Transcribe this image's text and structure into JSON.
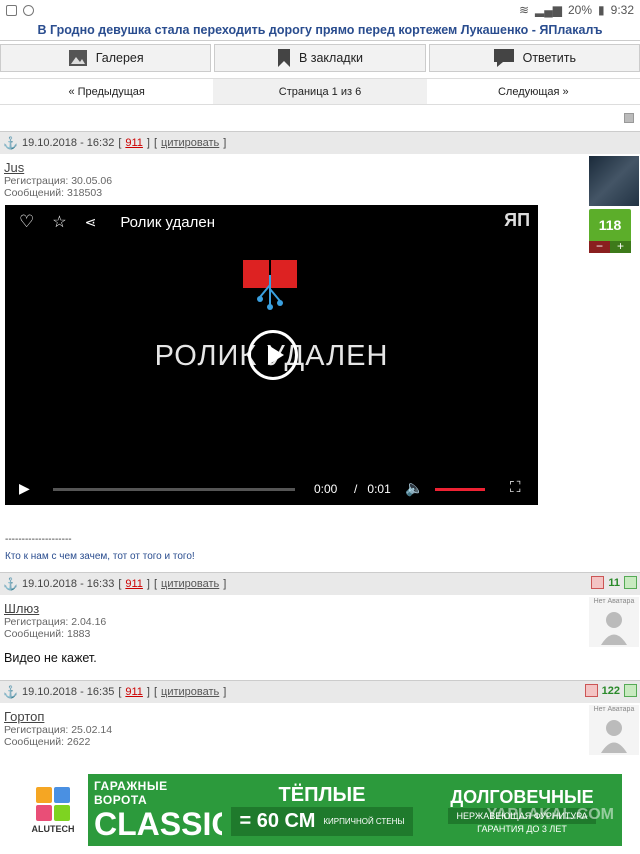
{
  "status": {
    "battery": "20%",
    "time": "9:32"
  },
  "title": "В Гродно девушка стала переходить дорогу прямо перед кортежем Лукашенко - ЯПлакалъ",
  "toolbar": {
    "gallery": "Галерея",
    "bookmarks": "В закладки",
    "reply": "Ответить"
  },
  "pager": {
    "prev": "« Предыдущая",
    "current": "Страница 1 из 6",
    "next": "Следующая »"
  },
  "posts": [
    {
      "date": "19.10.2018 - 16:32",
      "num": "911",
      "quote": "цитировать",
      "user": "Jus",
      "reg": "Регистрация: 30.05.06",
      "msgs": "Сообщений: 318503",
      "rating": "118",
      "minus": "−",
      "plus": "+",
      "video": {
        "title": "Ролик удален",
        "big": "РОЛИК УДАЛЕН",
        "logo": "ЯП",
        "time_cur": "0:00",
        "sep": "/",
        "time_total": "0:01"
      },
      "sig_line": "--------------------",
      "sig": "Кто к нам с чем зачем, тот от того и того!"
    },
    {
      "date": "19.10.2018 - 16:33",
      "num": "911",
      "quote": "цитировать",
      "user": "Шлюз",
      "reg": "Регистрация: 2.04.16",
      "msgs": "Сообщений: 1883",
      "rating": "11",
      "noavatar": "Нет Аватара",
      "text": "Видео не кажет."
    },
    {
      "date": "19.10.2018 - 16:35",
      "num": "911",
      "quote": "цитировать",
      "user": "Гортоп",
      "reg": "Регистрация: 25.02.14",
      "msgs": "Сообщений: 2622",
      "rating": "122",
      "noavatar": "Нет Аватара"
    }
  ],
  "banner": {
    "logo": "ALUTECH",
    "s1a": "ГАРАЖНЫЕ ВОРОТА",
    "s1b": "CLASSIC",
    "s2a": "ТЁПЛЫЕ",
    "s2b": "= 60 СМ",
    "s2c": "КИРПИЧНОЙ СТЕНЫ",
    "s3a": "ДОЛГОВЕЧНЫЕ",
    "s3b": "НЕРЖАВЕЮЩАЯ ФУРНИТУРА",
    "s3c": "ГАРАНТИЯ ДО 3 ЛЕТ",
    "watermark": "YAPLAKAL.COM"
  }
}
